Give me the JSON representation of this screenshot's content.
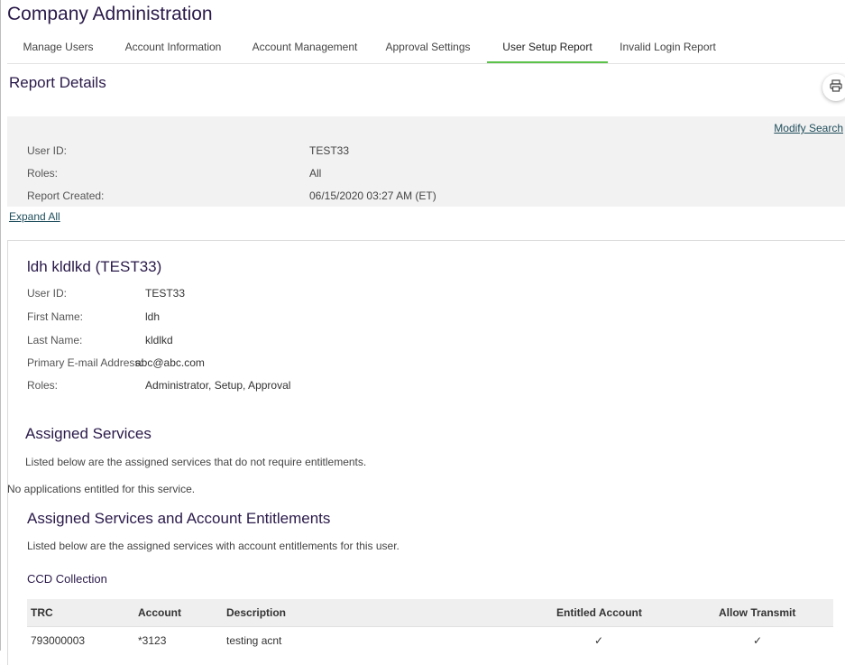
{
  "app": {
    "title": "Company Administration"
  },
  "tabs": [
    {
      "label": "Manage Users"
    },
    {
      "label": "Account Information"
    },
    {
      "label": "Account Management"
    },
    {
      "label": "Approval Settings"
    },
    {
      "label": "User Setup Report",
      "active": true
    },
    {
      "label": "Invalid Login Report"
    }
  ],
  "report": {
    "title": "Report Details",
    "print_icon": "printer-icon",
    "modify_search": "Modify Search",
    "summary": [
      {
        "label": "User ID:",
        "value": "TEST33"
      },
      {
        "label": "Roles:",
        "value": "All"
      },
      {
        "label": "Report Created:",
        "value": "06/15/2020 03:27 AM (ET)"
      }
    ],
    "expand_all": "Expand All"
  },
  "user": {
    "heading": "ldh kldlkd (TEST33)",
    "fields": [
      {
        "label": "User ID:",
        "value": "TEST33"
      },
      {
        "label": "First Name:",
        "value": "ldh"
      },
      {
        "label": "Last Name:",
        "value": "kldlkd"
      },
      {
        "label": "Primary E-mail Address:",
        "value": "abc@abc.com"
      },
      {
        "label": "Roles:",
        "value": "Administrator, Setup, Approval"
      }
    ]
  },
  "assigned_services": {
    "heading": "Assigned Services",
    "description": "Listed below are the assigned services that do not require entitlements.",
    "empty_message": "No applications entitled for this service."
  },
  "account_entitlements": {
    "heading": "Assigned Services and Account Entitlements",
    "description": "Listed below are the assigned services with account entitlements for this user.",
    "service_name": "CCD Collection",
    "columns": [
      "TRC",
      "Account",
      "Description",
      "Entitled Account",
      "Allow Transmit"
    ],
    "rows": [
      {
        "trc": "793000003",
        "account": "*3123",
        "description": "testing acnt",
        "entitled": "✓",
        "transmit": "✓"
      }
    ]
  },
  "colors": {
    "accent_tab": "#5cc34a",
    "heading": "#2a1a4a",
    "link": "#1f4e5c"
  }
}
